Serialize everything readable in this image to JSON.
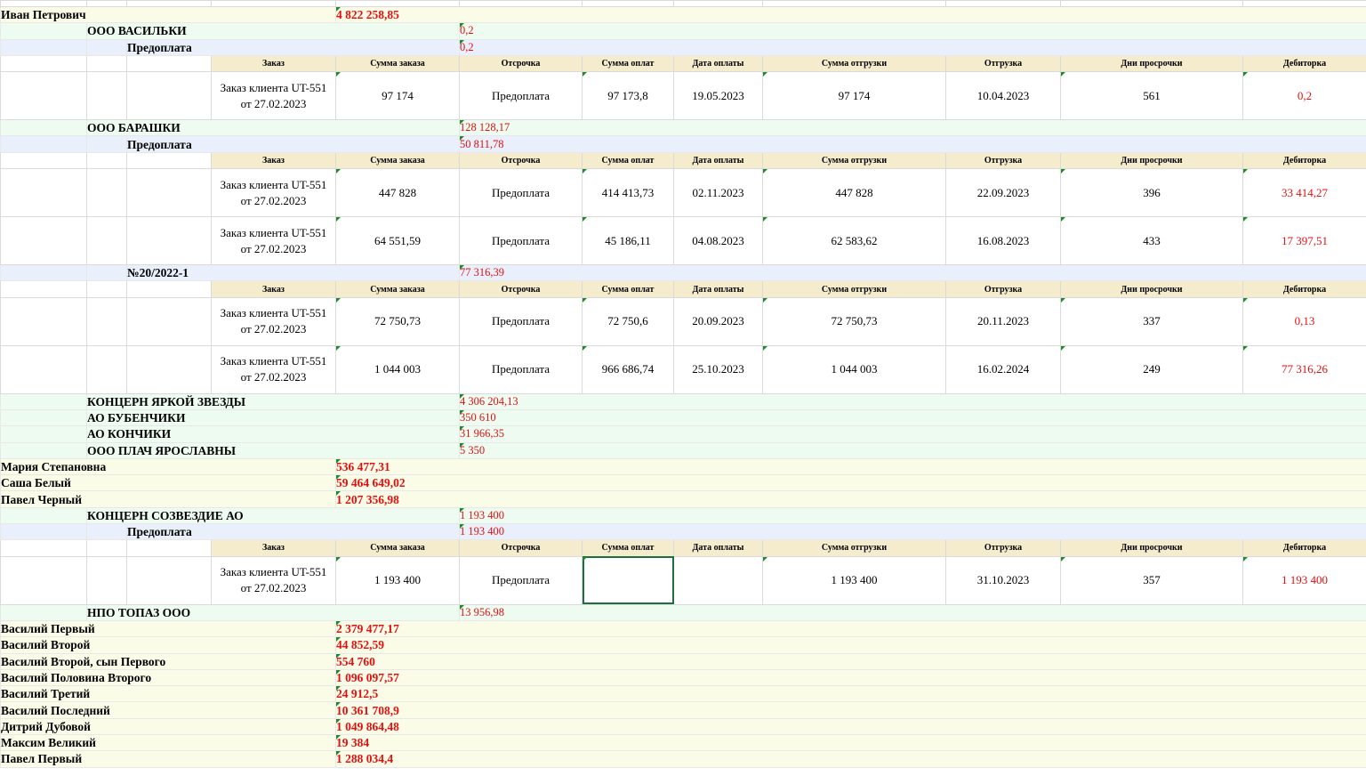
{
  "table_headers": {
    "order": "Заказ",
    "order_sum": "Сумма заказа",
    "deferral": "Отсрочка",
    "payment_sum": "Сумма оплат",
    "payment_date": "Дата оплаты",
    "shipment_sum": "Сумма отгрузки",
    "shipment": "Отгрузка",
    "overdue_days": "Дни просрочки",
    "receivables": "Дебиторка"
  },
  "rows": [
    {
      "kind": "top"
    },
    {
      "kind": "l1",
      "name": "Иван Петрович",
      "value": "4 822 258,85"
    },
    {
      "kind": "l2",
      "name": "ООО ВАСИЛЬКИ",
      "value": "0,2"
    },
    {
      "kind": "l3",
      "name": "Предоплата",
      "value": "0,2"
    },
    {
      "kind": "hdr"
    },
    {
      "kind": "data",
      "order": "Заказ клиента UT-551 от 27.02.2023",
      "order_sum": "97 174",
      "deferral": "Предоплата",
      "payment_sum": "97 173,8",
      "payment_date": "19.05.2023",
      "shipment_sum": "97 174",
      "shipment": "10.04.2023",
      "overdue_days": "561",
      "receivables": "0,2"
    },
    {
      "kind": "l2",
      "name": "ООО БАРАШКИ",
      "value": "128 128,17"
    },
    {
      "kind": "l3",
      "name": "Предоплата",
      "value": "50 811,78"
    },
    {
      "kind": "hdr"
    },
    {
      "kind": "data",
      "order": "Заказ клиента UT-551 от 27.02.2023",
      "order_sum": "447 828",
      "deferral": "Предоплата",
      "payment_sum": "414 413,73",
      "payment_date": "02.11.2023",
      "shipment_sum": "447 828",
      "shipment": "22.09.2023",
      "overdue_days": "396",
      "receivables": "33 414,27"
    },
    {
      "kind": "data",
      "order": "Заказ клиента UT-551 от 27.02.2023",
      "order_sum": "64 551,59",
      "deferral": "Предоплата",
      "payment_sum": "45 186,11",
      "payment_date": "04.08.2023",
      "shipment_sum": "62 583,62",
      "shipment": "16.08.2023",
      "overdue_days": "433",
      "receivables": "17 397,51"
    },
    {
      "kind": "l3",
      "name": "№20/2022-1",
      "value": "77 316,39"
    },
    {
      "kind": "hdr"
    },
    {
      "kind": "data",
      "order": "Заказ клиента UT-551 от 27.02.2023",
      "order_sum": "72 750,73",
      "deferral": "Предоплата",
      "payment_sum": "72 750,6",
      "payment_date": "20.09.2023",
      "shipment_sum": "72 750,73",
      "shipment": "20.11.2023",
      "overdue_days": "337",
      "receivables": "0,13"
    },
    {
      "kind": "data",
      "order": "Заказ клиента UT-551 от 27.02.2023",
      "order_sum": "1 044 003",
      "deferral": "Предоплата",
      "payment_sum": "966 686,74",
      "payment_date": "25.10.2023",
      "shipment_sum": "1 044 003",
      "shipment": "16.02.2024",
      "overdue_days": "249",
      "receivables": "77 316,26"
    },
    {
      "kind": "l2",
      "name": "КОНЦЕРН ЯРКОЙ ЗВЕЗДЫ",
      "value": "4 306 204,13"
    },
    {
      "kind": "l2",
      "name": "АО БУБЕНЧИКИ",
      "value": "350 610"
    },
    {
      "kind": "l2",
      "name": "АО КОНЧИКИ",
      "value": "31 966,35"
    },
    {
      "kind": "l2",
      "name": "ООО ПЛАЧ ЯРОСЛАВНЫ",
      "value": "5 350"
    },
    {
      "kind": "l1",
      "name": "Мария Степановна",
      "value": "536 477,31"
    },
    {
      "kind": "l1",
      "name": "Саша Белый",
      "value": "59 464 649,02"
    },
    {
      "kind": "l1",
      "name": "Павел Черный",
      "value": "1 207 356,98"
    },
    {
      "kind": "l2",
      "name": "КОНЦЕРН СОЗВЕЗДИЕ АО",
      "value": "1 193 400"
    },
    {
      "kind": "l3",
      "name": "Предоплата",
      "value": "1 193 400"
    },
    {
      "kind": "hdr"
    },
    {
      "kind": "data",
      "selected": true,
      "order": "Заказ клиента UT-551 от 27.02.2023",
      "order_sum": "1 193 400",
      "deferral": "Предоплата",
      "payment_sum": "",
      "payment_date": "",
      "shipment_sum": "1 193 400",
      "shipment": "31.10.2023",
      "overdue_days": "357",
      "receivables": "1 193 400"
    },
    {
      "kind": "l2",
      "name": "НПО ТОПАЗ ООО",
      "value": "13 956,98"
    },
    {
      "kind": "l1",
      "name": "Василий Первый",
      "value": "2 379 477,17"
    },
    {
      "kind": "l1",
      "name": "Василий Второй",
      "value": "44 852,59"
    },
    {
      "kind": "l1",
      "name": "Василий Второй, сын Первого",
      "value": "554 760"
    },
    {
      "kind": "l1",
      "name": "Василий Половина Второго",
      "value": "1 096 097,57"
    },
    {
      "kind": "l1",
      "name": "Василий Третий",
      "value": "24 912,5"
    },
    {
      "kind": "l1",
      "name": "Василий Последний",
      "value": "10 361 708,9"
    },
    {
      "kind": "l1",
      "name": "Дитрий Дубовой",
      "value": "1 049 864,48"
    },
    {
      "kind": "l1",
      "name": "Максим Великий",
      "value": "19 384"
    },
    {
      "kind": "l1",
      "name": "Павел Первый",
      "value": "1 288 034,4"
    }
  ]
}
